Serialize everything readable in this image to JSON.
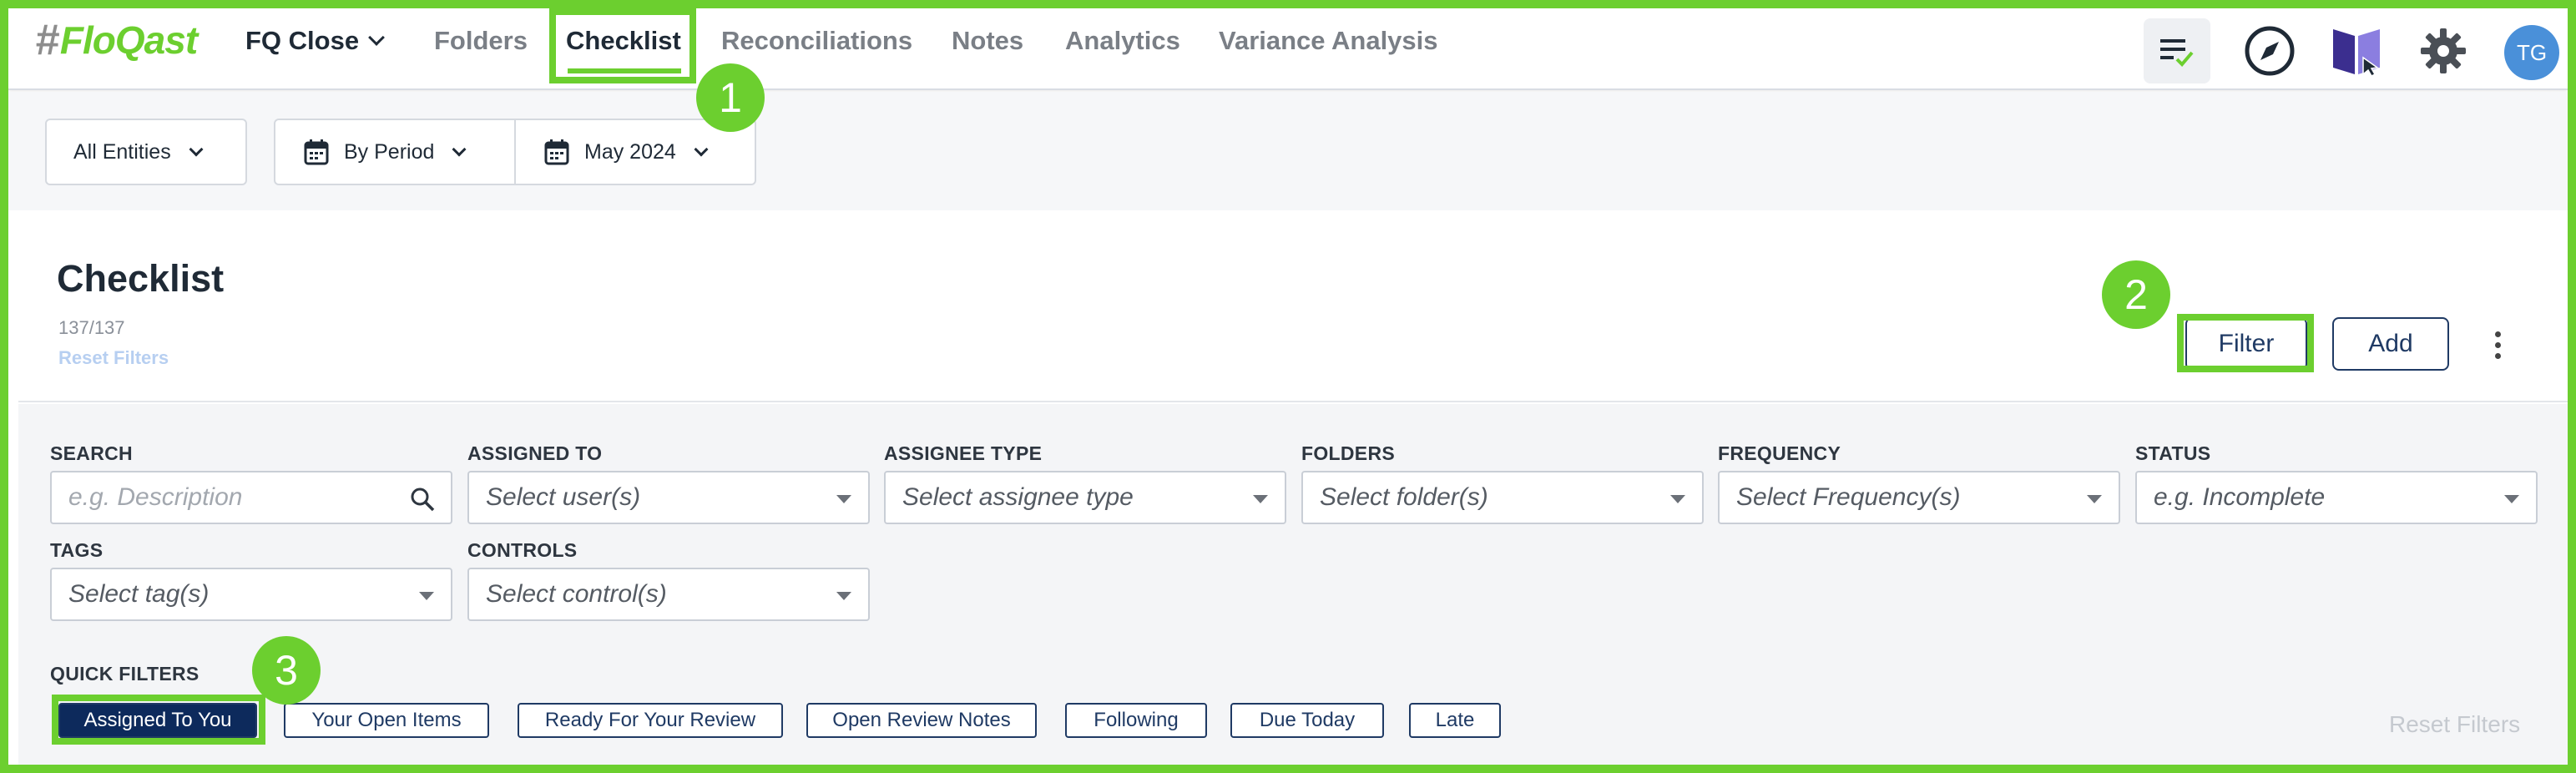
{
  "app": {
    "logo_hash": "#",
    "logo_text_flo": "Flo",
    "logo_text_qast": "Qast",
    "product_menu": "FQ Close",
    "avatar_initials": "TG",
    "accent_color": "#6ccf2f"
  },
  "nav": {
    "items": [
      "Folders",
      "Checklist",
      "Reconciliations",
      "Notes",
      "Analytics",
      "Variance Analysis"
    ],
    "active": "Checklist"
  },
  "annotations": {
    "one": "1",
    "two": "2",
    "three": "3"
  },
  "period_bar": {
    "entities": "All Entities",
    "period_mode": "By Period",
    "period_value": "May 2024"
  },
  "checklist": {
    "title": "Checklist",
    "count": "137/137",
    "reset_filters": "Reset Filters",
    "filter_button": "Filter",
    "add_button": "Add"
  },
  "filters": {
    "search": {
      "label": "SEARCH",
      "placeholder": "e.g. Description"
    },
    "assigned_to": {
      "label": "ASSIGNED TO",
      "placeholder": "Select user(s)"
    },
    "assignee_type": {
      "label": "ASSIGNEE TYPE",
      "placeholder": "Select assignee type"
    },
    "folders": {
      "label": "FOLDERS",
      "placeholder": "Select folder(s)"
    },
    "frequency": {
      "label": "FREQUENCY",
      "placeholder": "Select Frequency(s)"
    },
    "status": {
      "label": "STATUS",
      "placeholder": "e.g. Incomplete"
    },
    "tags": {
      "label": "TAGS",
      "placeholder": "Select tag(s)"
    },
    "controls": {
      "label": "CONTROLS",
      "placeholder": "Select control(s)"
    }
  },
  "quick_filters": {
    "label": "QUICK FILTERS",
    "chips": [
      "Assigned To You",
      "Your Open Items",
      "Ready For Your Review",
      "Open Review Notes",
      "Following",
      "Due Today",
      "Late"
    ],
    "active": "Assigned To You",
    "reset": "Reset Filters"
  }
}
